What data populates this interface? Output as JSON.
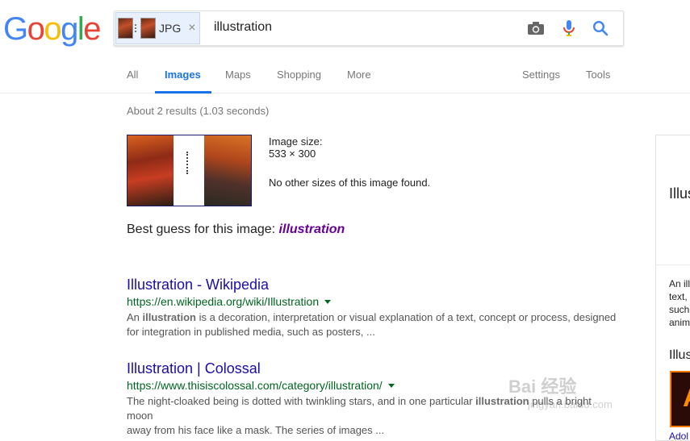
{
  "logo": {
    "letters": [
      {
        "char": "G",
        "color": "#4285F4"
      },
      {
        "char": "o",
        "color": "#EA4335"
      },
      {
        "char": "o",
        "color": "#FBBC05"
      },
      {
        "char": "g",
        "color": "#4285F4"
      },
      {
        "char": "l",
        "color": "#34A853"
      },
      {
        "char": "e",
        "color": "#EA4335"
      }
    ]
  },
  "search": {
    "chip_label": "JPG",
    "chip_close": "×",
    "query": "illustration",
    "icons": [
      "camera-icon",
      "microphone-icon",
      "search-icon"
    ]
  },
  "tabs": {
    "all": "All",
    "images": "Images",
    "maps": "Maps",
    "shopping": "Shopping",
    "more": "More",
    "settings": "Settings",
    "tools": "Tools",
    "active": "Images"
  },
  "stats": "About 2 results (1.03 seconds)",
  "image_info": {
    "size_label": "Image size:",
    "size_value": "533 × 300",
    "no_other_sizes": "No other sizes of this image found."
  },
  "best_guess": {
    "prefix": "Best guess for this image:",
    "term": "illustration"
  },
  "results": [
    {
      "title": "Illustration - Wikipedia",
      "url": "https://en.wikipedia.org/wiki/Illustration",
      "snippet_line1_pre": "An ",
      "snippet_line1_bold": "illustration",
      "snippet_line1_post": " is a decoration, interpretation or visual explanation of a text, concept or process, designed",
      "snippet_line2": "for integration in published media, such as posters, ..."
    },
    {
      "title": "Illustration | Colossal",
      "url": "https://www.thisiscolossal.com/category/illustration/",
      "snippet_line1_pre": "The night-cloaked being is dotted with twinkling stars, and in one particular ",
      "snippet_line1_bold": "illustration",
      "snippet_line1_post": " pulls a bright moon",
      "snippet_line2": "away from his face like a mask. The series of images ..."
    }
  ],
  "knowledge_panel": {
    "title": "Illus",
    "text_lines": [
      "An ill",
      "text,",
      "such",
      "anim"
    ],
    "sub_title": "Illus",
    "image_caption": "Adol"
  },
  "watermark": {
    "big": "Bai 经验",
    "small": "jingyan.baidu.com"
  }
}
